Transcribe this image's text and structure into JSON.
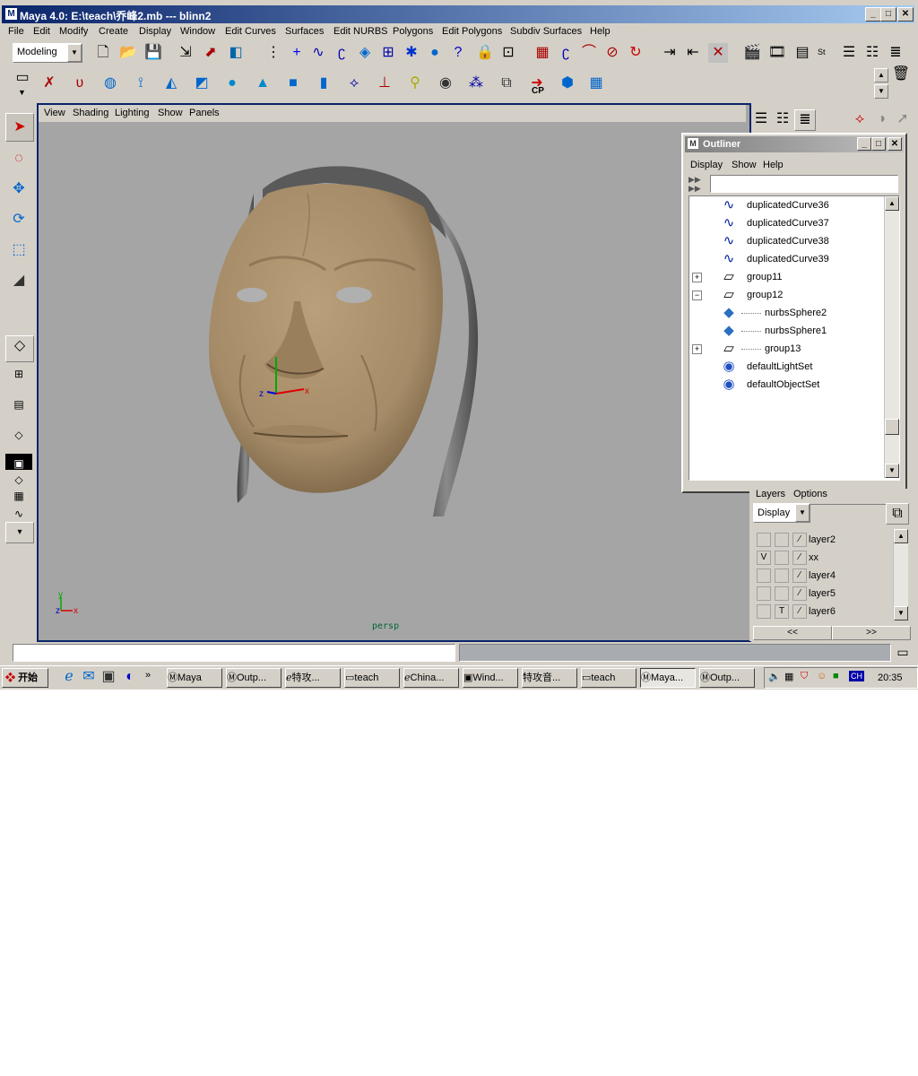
{
  "window": {
    "title": "Maya 4.0: E:\\teach\\乔峰2.mb  ---  blinn2"
  },
  "menubar": [
    "File",
    "Edit",
    "Modify",
    "Create",
    "Display",
    "Window",
    "Edit Curves",
    "Surfaces",
    "Edit NURBS",
    "Polygons",
    "Edit Polygons",
    "Subdiv Surfaces",
    "Help"
  ],
  "mode_select": {
    "value": "Modeling"
  },
  "viewport": {
    "menu": [
      "View",
      "Shading",
      "Lighting",
      "Show",
      "Panels"
    ],
    "camera_label": "persp",
    "axis_labels": {
      "x": "x",
      "y": "y",
      "z": "z"
    }
  },
  "outliner": {
    "title": "Outliner",
    "menu": [
      "Display",
      "Show",
      "Help"
    ],
    "search_value": "",
    "items": [
      {
        "label": "duplicatedCurve36",
        "icon": "nurbs-curve-icon",
        "indent": 0,
        "expander": ""
      },
      {
        "label": "duplicatedCurve37",
        "icon": "nurbs-curve-icon",
        "indent": 0,
        "expander": ""
      },
      {
        "label": "duplicatedCurve38",
        "icon": "nurbs-curve-icon",
        "indent": 0,
        "expander": ""
      },
      {
        "label": "duplicatedCurve39",
        "icon": "nurbs-curve-icon",
        "indent": 0,
        "expander": ""
      },
      {
        "label": "group11",
        "icon": "group-icon",
        "indent": 0,
        "expander": "+"
      },
      {
        "label": "group12",
        "icon": "group-icon",
        "indent": 0,
        "expander": "−"
      },
      {
        "label": "nurbsSphere2",
        "icon": "nurbs-surface-icon",
        "indent": 1,
        "expander": ""
      },
      {
        "label": "nurbsSphere1",
        "icon": "nurbs-surface-icon",
        "indent": 1,
        "expander": ""
      },
      {
        "label": "group13",
        "icon": "group-icon",
        "indent": 1,
        "expander": "+"
      },
      {
        "label": "defaultLightSet",
        "icon": "set-icon",
        "indent": 0,
        "expander": ""
      },
      {
        "label": "defaultObjectSet",
        "icon": "set-icon",
        "indent": 0,
        "expander": ""
      }
    ]
  },
  "layers": {
    "tabs": [
      "Layers",
      "Options"
    ],
    "display_select": "Display",
    "rows": [
      {
        "v": "",
        "t": "",
        "name": "layer2"
      },
      {
        "v": "V",
        "t": "",
        "name": "xx"
      },
      {
        "v": "",
        "t": "",
        "name": "layer4"
      },
      {
        "v": "",
        "t": "",
        "name": "layer5"
      },
      {
        "v": "",
        "t": "T",
        "name": "layer6"
      }
    ],
    "nav_prev": "<<",
    "nav_next": ">>"
  },
  "command_line": {
    "value": ""
  },
  "toolbar_labels": {
    "st": "St",
    "cp": "CP"
  },
  "taskbar": {
    "start": "开始",
    "tasks": [
      {
        "label": "Maya",
        "active": false
      },
      {
        "label": "Outp...",
        "active": false
      },
      {
        "label": "特攻...",
        "active": false
      },
      {
        "label": "teach",
        "active": false
      },
      {
        "label": "China...",
        "active": false
      },
      {
        "label": "Wind...",
        "active": false
      },
      {
        "label": "特攻音...",
        "active": false
      },
      {
        "label": "teach",
        "active": false
      },
      {
        "label": "Maya...",
        "active": true
      },
      {
        "label": "Outp...",
        "active": false
      }
    ],
    "lang": "CH",
    "clock": "20:35"
  },
  "colors": {
    "title_blue": "#0a246a",
    "viewport_bg": "#a5a5a5",
    "face_skin": "#a58b67",
    "hair": "#6a6a6a"
  }
}
